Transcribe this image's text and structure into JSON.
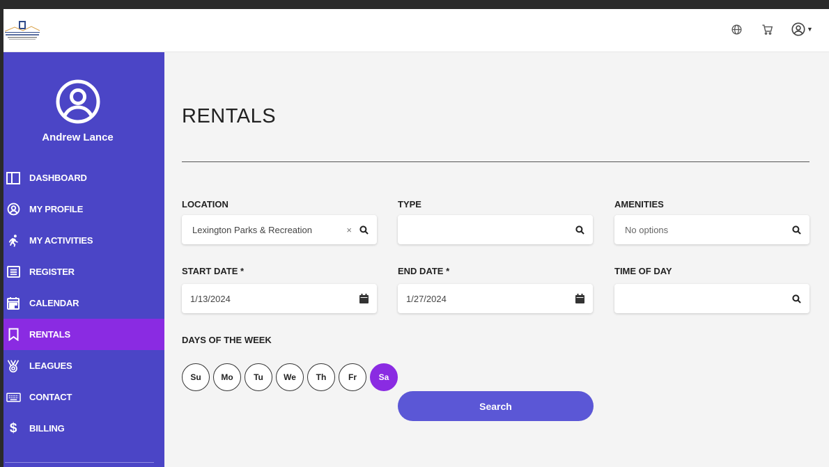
{
  "header": {
    "logo_text": "LEXINGTON",
    "icons": [
      "globe-icon",
      "cart-icon",
      "account-icon"
    ]
  },
  "sidebar": {
    "user_name": "Andrew Lance",
    "items": [
      {
        "label": "DASHBOARD",
        "icon": "dashboard-icon"
      },
      {
        "label": "MY PROFILE",
        "icon": "profile-icon"
      },
      {
        "label": "MY ACTIVITIES",
        "icon": "activities-icon"
      },
      {
        "label": "REGISTER",
        "icon": "register-icon"
      },
      {
        "label": "CALENDAR",
        "icon": "calendar-icon"
      },
      {
        "label": "RENTALS",
        "icon": "bookmark-icon",
        "active": true
      },
      {
        "label": "LEAGUES",
        "icon": "medal-icon"
      },
      {
        "label": "CONTACT",
        "icon": "keyboard-icon"
      },
      {
        "label": "BILLING",
        "icon": "dollar-icon"
      }
    ]
  },
  "main": {
    "title": "RENTALS",
    "location": {
      "label": "LOCATION",
      "value": "Lexington Parks & Recreation",
      "clear": "×"
    },
    "type": {
      "label": "TYPE",
      "value": ""
    },
    "amenities": {
      "label": "AMENITIES",
      "placeholder": "No options"
    },
    "start_date": {
      "label": "START DATE *",
      "value": "1/13/2024"
    },
    "end_date": {
      "label": "END DATE *",
      "value": "1/27/2024"
    },
    "time_of_day": {
      "label": "TIME OF DAY",
      "value": ""
    },
    "days_label": "DAYS OF THE WEEK",
    "days": [
      "Su",
      "Mo",
      "Tu",
      "We",
      "Th",
      "Fr",
      "Sa"
    ],
    "selected_day": "Sa",
    "search_label": "Search"
  },
  "colors": {
    "sidebar": "#4b45c6",
    "active": "#8a2be2",
    "button": "#5b57d6"
  }
}
